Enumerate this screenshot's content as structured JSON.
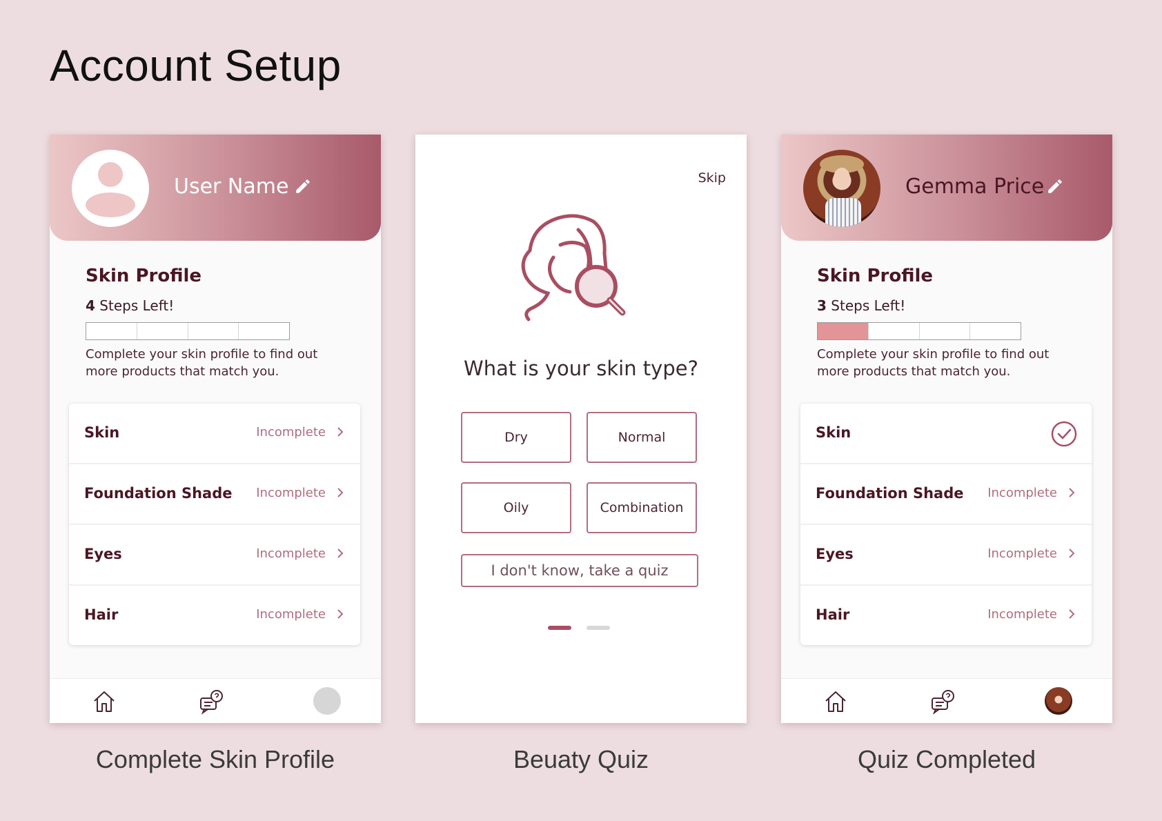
{
  "page_title": "Account Setup",
  "captions": [
    "Complete Skin Profile",
    "Beuaty Quiz",
    "Quiz Completed"
  ],
  "screen1": {
    "user_name": "User Name",
    "skin_profile_title": "Skin Profile",
    "steps_number": "4",
    "steps_text": " Steps Left!",
    "progress": {
      "filled_steps": 0,
      "total_steps": 4
    },
    "description": "Complete your skin profile to find out more products that match you.",
    "rows": [
      {
        "label": "Skin",
        "status": "Incomplete"
      },
      {
        "label": "Foundation Shade",
        "status": "Incomplete"
      },
      {
        "label": "Eyes",
        "status": "Incomplete"
      },
      {
        "label": "Hair",
        "status": "Incomplete"
      }
    ]
  },
  "screen2": {
    "skip_label": "Skip",
    "question": "What is your skin type?",
    "options": [
      "Dry",
      "Normal",
      "Oily",
      "Combination"
    ],
    "quiz_button": "I don't know, take a quiz",
    "pagination": {
      "current": 1,
      "total": 2
    }
  },
  "screen3": {
    "user_name": "Gemma Price",
    "skin_profile_title": "Skin Profile",
    "steps_number": "3",
    "steps_text": " Steps Left!",
    "progress": {
      "filled_steps": 1,
      "total_steps": 4
    },
    "description": "Complete your skin profile to find out more products that match you.",
    "rows": [
      {
        "label": "Skin",
        "status": "complete"
      },
      {
        "label": "Foundation Shade",
        "status": "Incomplete"
      },
      {
        "label": "Eyes",
        "status": "Incomplete"
      },
      {
        "label": "Hair",
        "status": "Incomplete"
      }
    ]
  },
  "icons": {
    "edit": "pencil-icon",
    "chevron": "chevron-right-icon",
    "check": "check-circle-icon",
    "home": "home-icon",
    "chat": "chat-question-icon",
    "profile": "avatar-icon",
    "quiz_illustration": "face-magnifier-icon"
  },
  "colors": {
    "background": "#eddde1",
    "accent": "#a94e62",
    "status_text": "#b06d7e",
    "progress_fill": "#e39497",
    "header_gradient_start": "#ecc7c7",
    "header_gradient_end": "#a85a6a"
  }
}
